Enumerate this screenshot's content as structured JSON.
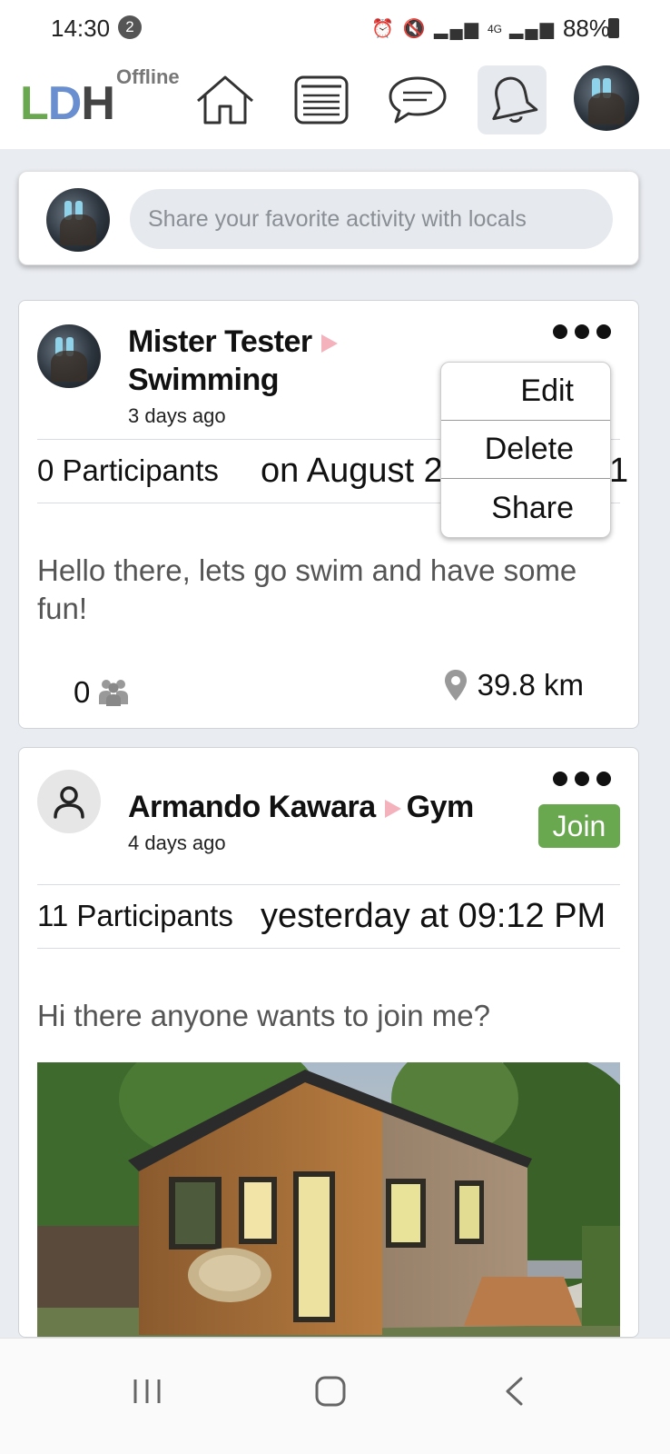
{
  "status_bar": {
    "time": "14:30",
    "notification_count": "2",
    "network": "4G",
    "battery": "88%"
  },
  "top_nav": {
    "logo": {
      "l": "L",
      "d": "D",
      "h": "H"
    },
    "status": "Offline",
    "active_tab": "notifications"
  },
  "composer": {
    "placeholder": "Share your favorite activity with locals"
  },
  "posts": [
    {
      "author": "Mister Tester",
      "activity": "Swimming",
      "time_ago": "3 days ago",
      "participants": "0 Participants",
      "when": "on August 2",
      "when_tail": "1",
      "body": "Hello there, lets go swim and have some fun!",
      "participant_count": "0",
      "distance": "39.8 km",
      "menu": [
        "Edit",
        "Delete",
        "Share"
      ]
    },
    {
      "author": "Armando Kawara",
      "activity": "Gym",
      "time_ago": "4 days ago",
      "join_label": "Join",
      "participants": "11 Participants",
      "when": "yesterday at 09:12 PM",
      "body": "Hi there anyone wants to join me?"
    }
  ],
  "colors": {
    "brand_green": "#6aa84f",
    "brand_blue": "#6a8fd0",
    "activity_arrow": "#f4b2bd",
    "background": "#e9ecf1"
  }
}
